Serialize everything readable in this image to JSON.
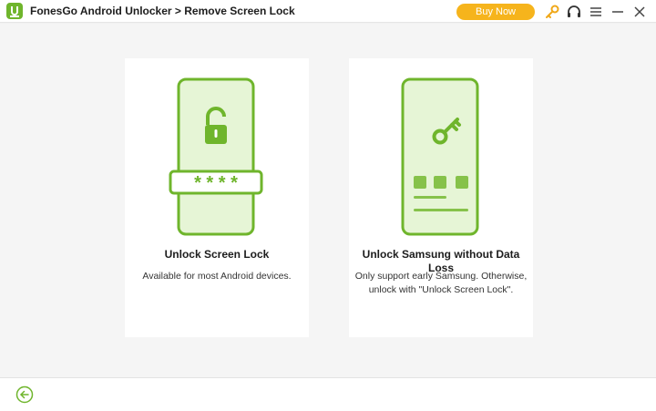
{
  "window": {
    "title": "FonesGo Android Unlocker > Remove Screen Lock",
    "buy_label": "Buy Now",
    "accent_color": "#6fb52c",
    "buy_color": "#f6b41c",
    "icons": [
      "key-icon",
      "headset-icon",
      "menu-icon",
      "minimize-icon",
      "close-icon"
    ]
  },
  "cards": [
    {
      "title": "Unlock Screen Lock",
      "description": "Available for most Android devices.",
      "icon": "unlock-padlock-icon",
      "password_mask": "* * * *"
    },
    {
      "title": "Unlock Samsung without Data Loss",
      "description": "Only support early Samsung. Otherwise, unlock with \"Unlock Screen Lock\".",
      "icon": "key-icon"
    }
  ],
  "footer": {
    "back_icon": "back-arrow-icon"
  }
}
